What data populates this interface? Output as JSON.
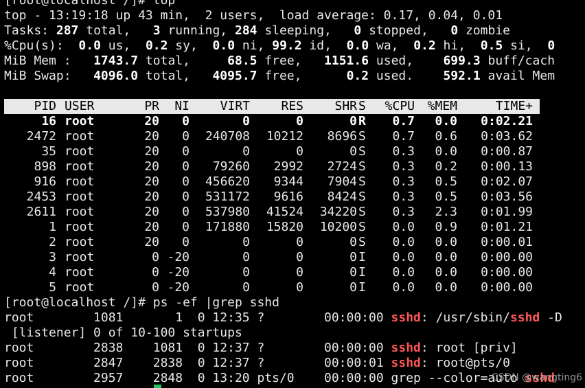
{
  "prompt_top": "[root@localhost /]# top",
  "summary": {
    "line1": "top - 13:19:18 up 43 min,  2 users,  load average: 0.17, 0.04, 0.01",
    "tasks": {
      "label": "Tasks:",
      "total": "287",
      "total_l": " total,",
      "running": "3",
      "running_l": " running,",
      "sleeping": "284",
      "sleeping_l": " sleeping,",
      "stopped": "0",
      "stopped_l": " stopped,",
      "zombie": "0",
      "zombie_l": " zombie"
    },
    "cpu": {
      "label": "%Cpu(s):",
      "us": "0.0",
      "us_l": " us,",
      "sy": "0.2",
      "sy_l": " sy,",
      "ni": "0.0",
      "ni_l": " ni,",
      "id": "99.2",
      "id_l": " id,",
      "wa": "0.0",
      "wa_l": " wa,",
      "hi": "0.2",
      "hi_l": " hi,",
      "si": "0.5",
      "si_l": " si,",
      "st": "0"
    },
    "mem": {
      "label": "MiB Mem :",
      "total": "1743.7",
      "total_l": " total,",
      "free": "68.5",
      "free_l": " free,",
      "used": "1151.6",
      "used_l": " used,",
      "buff": "699.3",
      "buff_l": " buff/cach"
    },
    "swap": {
      "label": "MiB Swap:",
      "total": "4096.0",
      "total_l": " total,",
      "free": "4095.7",
      "free_l": " free,",
      "used": "0.2",
      "used_l": " used.",
      "avail": "592.1",
      "avail_l": " avail Mem"
    }
  },
  "columns": [
    "PID",
    "USER",
    "PR",
    "NI",
    "VIRT",
    "RES",
    "SHR",
    "S",
    "%CPU",
    "%MEM",
    "TIME+"
  ],
  "processes": [
    [
      "16",
      "root",
      "20",
      "0",
      "0",
      "0",
      "0",
      "R",
      "0.7",
      "0.0",
      "0:02.21"
    ],
    [
      "2472",
      "root",
      "20",
      "0",
      "240708",
      "10212",
      "8696",
      "S",
      "0.7",
      "0.6",
      "0:03.62"
    ],
    [
      "35",
      "root",
      "20",
      "0",
      "0",
      "0",
      "0",
      "S",
      "0.3",
      "0.0",
      "0:00.87"
    ],
    [
      "898",
      "root",
      "20",
      "0",
      "79260",
      "2992",
      "2724",
      "S",
      "0.3",
      "0.2",
      "0:00.13"
    ],
    [
      "916",
      "root",
      "20",
      "0",
      "456620",
      "9344",
      "7904",
      "S",
      "0.3",
      "0.5",
      "0:02.07"
    ],
    [
      "2453",
      "root",
      "20",
      "0",
      "531172",
      "9616",
      "8424",
      "S",
      "0.3",
      "0.5",
      "0:03.56"
    ],
    [
      "2611",
      "root",
      "20",
      "0",
      "537980",
      "41524",
      "34220",
      "S",
      "0.3",
      "2.3",
      "0:01.99"
    ],
    [
      "1",
      "root",
      "20",
      "0",
      "171880",
      "15820",
      "10200",
      "S",
      "0.0",
      "0.9",
      "0:01.21"
    ],
    [
      "2",
      "root",
      "20",
      "0",
      "0",
      "0",
      "0",
      "S",
      "0.0",
      "0.0",
      "0:00.01"
    ],
    [
      "3",
      "root",
      "0",
      "-20",
      "0",
      "0",
      "0",
      "I",
      "0.0",
      "0.0",
      "0:00.00"
    ],
    [
      "4",
      "root",
      "0",
      "-20",
      "0",
      "0",
      "0",
      "I",
      "0.0",
      "0.0",
      "0:00.00"
    ],
    [
      "5",
      "root",
      "0",
      "-20",
      "0",
      "0",
      "0",
      "I",
      "0.0",
      "0.0",
      "0:00.00"
    ]
  ],
  "prompt_ps": "[root@localhost /]# ps -ef |grep sshd",
  "ps_lines": [
    {
      "pre": "root        1081       1  0 12:35 ?        00:00:00 ",
      "hl1": "sshd",
      "mid": ": /usr/sbin/",
      "hl2": "sshd",
      "post": " -D"
    },
    {
      "pre": " [listener] 0 of 10-100 startups",
      "hl1": "",
      "mid": "",
      "hl2": "",
      "post": ""
    },
    {
      "pre": "root        2838    1081  0 12:37 ?        00:00:00 ",
      "hl1": "sshd",
      "mid": ": root [priv]",
      "hl2": "",
      "post": ""
    },
    {
      "pre": "root        2847    2838  0 12:37 ?        00:00:01 ",
      "hl1": "sshd",
      "mid": ": root@pts/0",
      "hl2": "",
      "post": ""
    },
    {
      "pre": "root        2957    2848  0 13:20 pts/0    00:00:00 grep --color=auto ",
      "hl1": "sshd",
      "mid": "",
      "hl2": "",
      "post": ""
    }
  ],
  "watermark": "CSDN @wangting6",
  "colors": {
    "background": "#000000",
    "foreground": "#e8e8e8",
    "highlight": "#ff5555",
    "header_bar": "#e8e8e8",
    "cursor": "#22c55e"
  }
}
